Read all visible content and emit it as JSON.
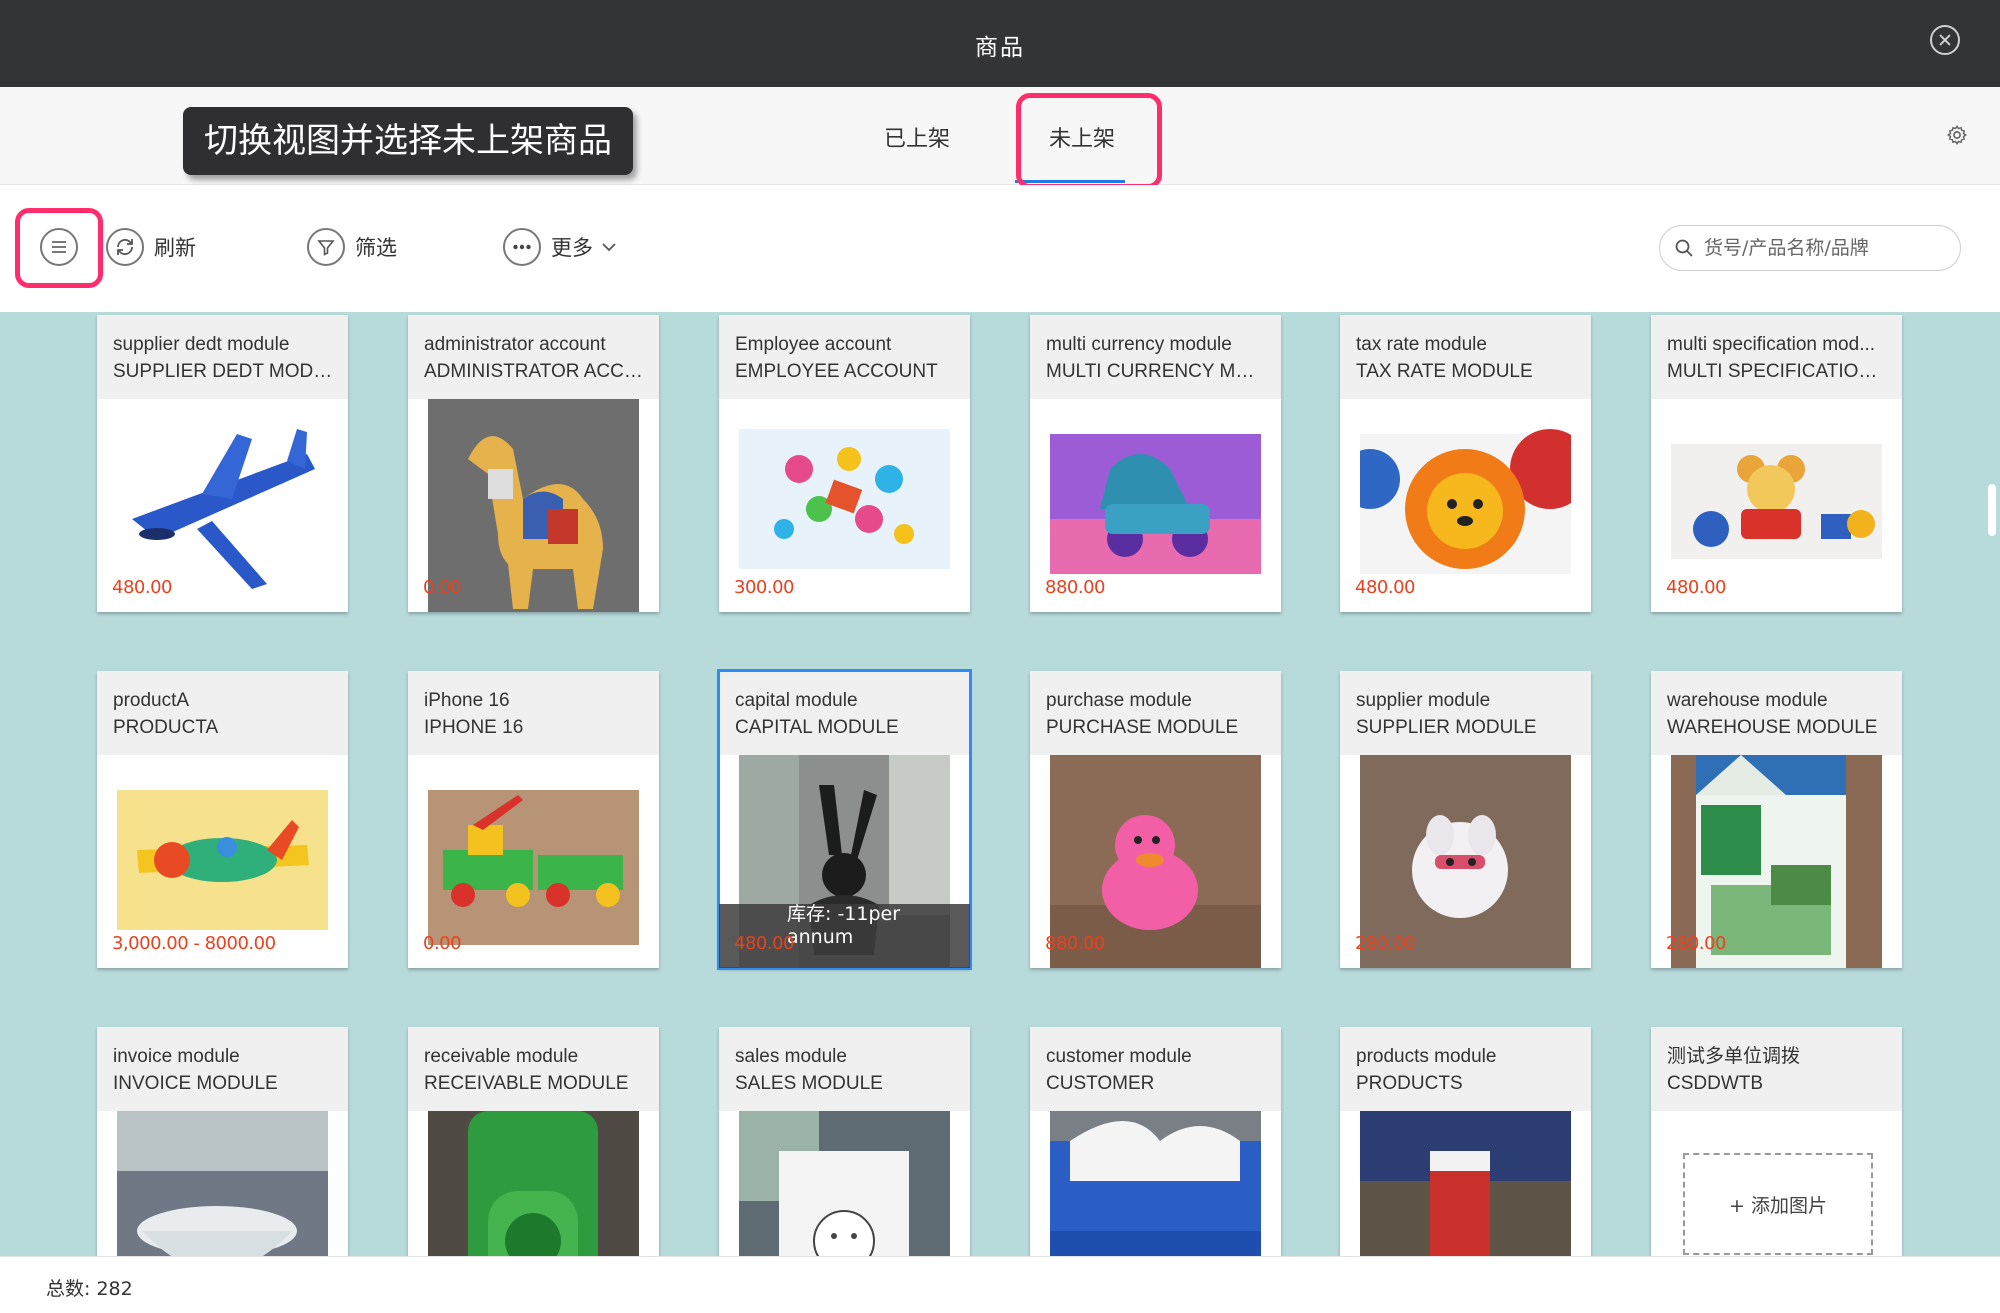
{
  "window": {
    "title": "商品"
  },
  "tooltip": {
    "text": "切换视图并选择未上架商品"
  },
  "tabs": [
    {
      "label": "已上架"
    },
    {
      "label": "未上架"
    }
  ],
  "toolbar": {
    "refresh_label": "刷新",
    "filter_label": "筛选",
    "more_label": "更多",
    "search_placeholder": "货号/产品名称/品牌"
  },
  "products": [
    {
      "name": "supplier dedt module",
      "code": "SUPPLIER DEDT MODULE",
      "price": "480.00",
      "image": "blue-plane"
    },
    {
      "name": "administrator account",
      "code": "ADMINISTRATOR ACCO...",
      "price": "0.00",
      "image": "patchwork-camel"
    },
    {
      "name": "Employee account",
      "code": "EMPLOYEE ACCOUNT",
      "price": "300.00",
      "image": "building-blocks"
    },
    {
      "name": "multi currency module",
      "code": "MULTI CURRENCY MOD...",
      "price": "880.00",
      "image": "toy-car"
    },
    {
      "name": "tax rate module",
      "code": "TAX RATE MODULE",
      "price": "480.00",
      "image": "lion-ball"
    },
    {
      "name": "multi specification mod...",
      "code": "MULTI SPECIFICATION M...",
      "price": "480.00",
      "image": "mouse-toy"
    },
    {
      "name": "productA",
      "code": "PRODUCTA",
      "price": "3,000.00 - 8000.00",
      "image": "toy-plane"
    },
    {
      "name": "iPhone 16",
      "code": "IPHONE 16",
      "price": "0.00",
      "image": "toy-truck"
    },
    {
      "name": "capital module",
      "code": "CAPITAL MODULE",
      "price": "480.00",
      "stock": "库存: -11per annum",
      "image": "figurine"
    },
    {
      "name": "purchase module",
      "code": "PURCHASE MODULE",
      "price": "880.00",
      "image": "pink-duck"
    },
    {
      "name": "supplier module",
      "code": "SUPPLIER MODULE",
      "price": "280.00",
      "image": "white-toy"
    },
    {
      "name": "warehouse module",
      "code": "WAREHOUSE MODULE",
      "price": "280.00",
      "image": "milk-carton"
    },
    {
      "name": "invoice module",
      "code": "INVOICE MODULE",
      "image": "glass-bowl"
    },
    {
      "name": "receivable module",
      "code": "RECEIVABLE MODULE",
      "image": "green-bottle"
    },
    {
      "name": "sales module",
      "code": "SALES MODULE",
      "image": "mug"
    },
    {
      "name": "customer module",
      "code": "CUSTOMER",
      "image": "tissue"
    },
    {
      "name": "products module",
      "code": "PRODUCTS",
      "image": "red-box"
    },
    {
      "name": "测试多单位调拨",
      "code": "CSDDWTB",
      "add_image_label": "+ 添加图片"
    }
  ],
  "footer": {
    "total_label": "总数:",
    "total_value": "282"
  },
  "colors": {
    "highlight": "#ff2d6b",
    "accent": "#1f7be8",
    "price": "#e8421f",
    "grid_bg": "#b7dadb"
  }
}
